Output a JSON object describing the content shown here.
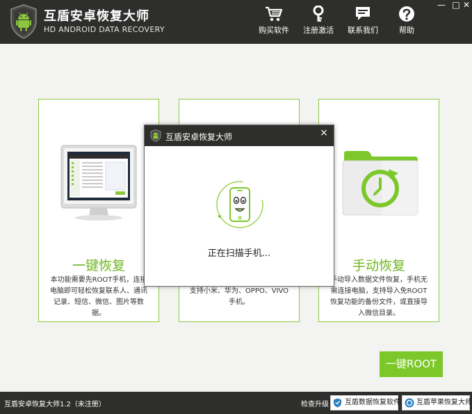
{
  "header": {
    "title": "互盾安卓恢复大师",
    "subtitle": "HD ANDROID DATA RECOVERY",
    "nav": [
      {
        "label": "购买软件",
        "icon": "cart-icon"
      },
      {
        "label": "注册激活",
        "icon": "key-icon"
      },
      {
        "label": "联系我们",
        "icon": "chat-icon"
      },
      {
        "label": "帮助",
        "icon": "help-icon"
      }
    ],
    "window": {
      "minimize": "—",
      "maximize": "□",
      "close": "✕"
    }
  },
  "cards": [
    {
      "title": "一键恢复",
      "desc": "本功能需要先ROOT手机，连接电脑即可轻松恢复联系人、通讯记录、短信、微信、图片等数据。"
    },
    {
      "title": "",
      "desc": "用手机数据备份文件进行恢复，支持小米、华为、OPPO、VIVO手机。"
    },
    {
      "title": "手动恢复",
      "desc": "手动导入数据文件恢复，手机无需连接电脑，支持导入免ROOT恢复功能的备份文件，或直接导入微信目录。"
    }
  ],
  "dialog": {
    "title": "互盾安卓恢复大师",
    "close": "×",
    "status": "正在扫描手机..."
  },
  "root_button": "一键ROOT",
  "statusbar": {
    "version": "互盾安卓恢复大师1.2（未注册）",
    "upgrade": "检查升级",
    "buttons": [
      "互盾数据恢复软件",
      "互盾苹果恢复大师"
    ]
  },
  "colors": {
    "accent": "#7cc82a",
    "header": "#2e2e2c",
    "border": "#8cc63f"
  }
}
